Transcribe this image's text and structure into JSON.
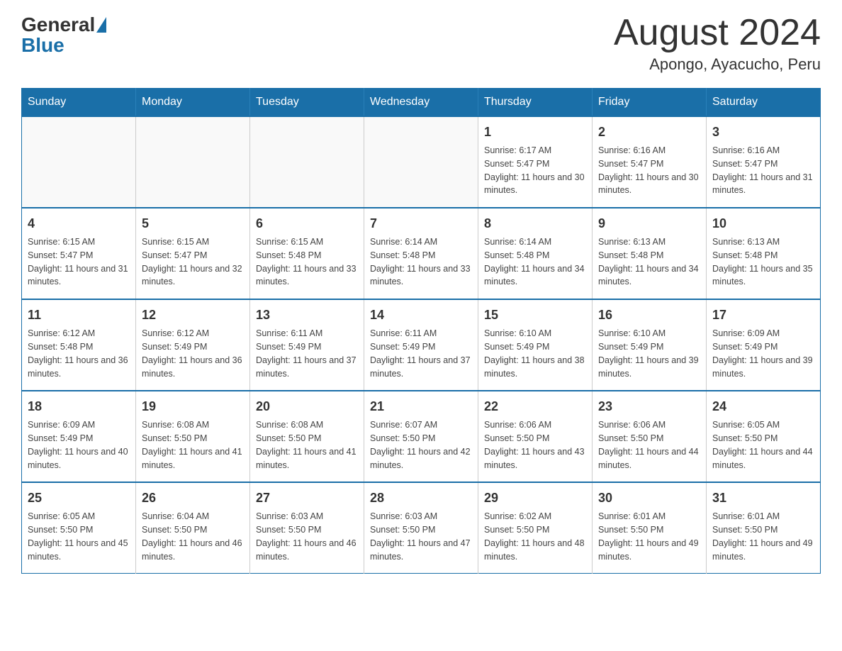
{
  "header": {
    "logo_general": "General",
    "logo_blue": "Blue",
    "title": "August 2024",
    "subtitle": "Apongo, Ayacucho, Peru"
  },
  "calendar": {
    "days_of_week": [
      "Sunday",
      "Monday",
      "Tuesday",
      "Wednesday",
      "Thursday",
      "Friday",
      "Saturday"
    ],
    "weeks": [
      [
        {
          "day": "",
          "info": ""
        },
        {
          "day": "",
          "info": ""
        },
        {
          "day": "",
          "info": ""
        },
        {
          "day": "",
          "info": ""
        },
        {
          "day": "1",
          "info": "Sunrise: 6:17 AM\nSunset: 5:47 PM\nDaylight: 11 hours and 30 minutes."
        },
        {
          "day": "2",
          "info": "Sunrise: 6:16 AM\nSunset: 5:47 PM\nDaylight: 11 hours and 30 minutes."
        },
        {
          "day": "3",
          "info": "Sunrise: 6:16 AM\nSunset: 5:47 PM\nDaylight: 11 hours and 31 minutes."
        }
      ],
      [
        {
          "day": "4",
          "info": "Sunrise: 6:15 AM\nSunset: 5:47 PM\nDaylight: 11 hours and 31 minutes."
        },
        {
          "day": "5",
          "info": "Sunrise: 6:15 AM\nSunset: 5:47 PM\nDaylight: 11 hours and 32 minutes."
        },
        {
          "day": "6",
          "info": "Sunrise: 6:15 AM\nSunset: 5:48 PM\nDaylight: 11 hours and 33 minutes."
        },
        {
          "day": "7",
          "info": "Sunrise: 6:14 AM\nSunset: 5:48 PM\nDaylight: 11 hours and 33 minutes."
        },
        {
          "day": "8",
          "info": "Sunrise: 6:14 AM\nSunset: 5:48 PM\nDaylight: 11 hours and 34 minutes."
        },
        {
          "day": "9",
          "info": "Sunrise: 6:13 AM\nSunset: 5:48 PM\nDaylight: 11 hours and 34 minutes."
        },
        {
          "day": "10",
          "info": "Sunrise: 6:13 AM\nSunset: 5:48 PM\nDaylight: 11 hours and 35 minutes."
        }
      ],
      [
        {
          "day": "11",
          "info": "Sunrise: 6:12 AM\nSunset: 5:48 PM\nDaylight: 11 hours and 36 minutes."
        },
        {
          "day": "12",
          "info": "Sunrise: 6:12 AM\nSunset: 5:49 PM\nDaylight: 11 hours and 36 minutes."
        },
        {
          "day": "13",
          "info": "Sunrise: 6:11 AM\nSunset: 5:49 PM\nDaylight: 11 hours and 37 minutes."
        },
        {
          "day": "14",
          "info": "Sunrise: 6:11 AM\nSunset: 5:49 PM\nDaylight: 11 hours and 37 minutes."
        },
        {
          "day": "15",
          "info": "Sunrise: 6:10 AM\nSunset: 5:49 PM\nDaylight: 11 hours and 38 minutes."
        },
        {
          "day": "16",
          "info": "Sunrise: 6:10 AM\nSunset: 5:49 PM\nDaylight: 11 hours and 39 minutes."
        },
        {
          "day": "17",
          "info": "Sunrise: 6:09 AM\nSunset: 5:49 PM\nDaylight: 11 hours and 39 minutes."
        }
      ],
      [
        {
          "day": "18",
          "info": "Sunrise: 6:09 AM\nSunset: 5:49 PM\nDaylight: 11 hours and 40 minutes."
        },
        {
          "day": "19",
          "info": "Sunrise: 6:08 AM\nSunset: 5:50 PM\nDaylight: 11 hours and 41 minutes."
        },
        {
          "day": "20",
          "info": "Sunrise: 6:08 AM\nSunset: 5:50 PM\nDaylight: 11 hours and 41 minutes."
        },
        {
          "day": "21",
          "info": "Sunrise: 6:07 AM\nSunset: 5:50 PM\nDaylight: 11 hours and 42 minutes."
        },
        {
          "day": "22",
          "info": "Sunrise: 6:06 AM\nSunset: 5:50 PM\nDaylight: 11 hours and 43 minutes."
        },
        {
          "day": "23",
          "info": "Sunrise: 6:06 AM\nSunset: 5:50 PM\nDaylight: 11 hours and 44 minutes."
        },
        {
          "day": "24",
          "info": "Sunrise: 6:05 AM\nSunset: 5:50 PM\nDaylight: 11 hours and 44 minutes."
        }
      ],
      [
        {
          "day": "25",
          "info": "Sunrise: 6:05 AM\nSunset: 5:50 PM\nDaylight: 11 hours and 45 minutes."
        },
        {
          "day": "26",
          "info": "Sunrise: 6:04 AM\nSunset: 5:50 PM\nDaylight: 11 hours and 46 minutes."
        },
        {
          "day": "27",
          "info": "Sunrise: 6:03 AM\nSunset: 5:50 PM\nDaylight: 11 hours and 46 minutes."
        },
        {
          "day": "28",
          "info": "Sunrise: 6:03 AM\nSunset: 5:50 PM\nDaylight: 11 hours and 47 minutes."
        },
        {
          "day": "29",
          "info": "Sunrise: 6:02 AM\nSunset: 5:50 PM\nDaylight: 11 hours and 48 minutes."
        },
        {
          "day": "30",
          "info": "Sunrise: 6:01 AM\nSunset: 5:50 PM\nDaylight: 11 hours and 49 minutes."
        },
        {
          "day": "31",
          "info": "Sunrise: 6:01 AM\nSunset: 5:50 PM\nDaylight: 11 hours and 49 minutes."
        }
      ]
    ]
  }
}
